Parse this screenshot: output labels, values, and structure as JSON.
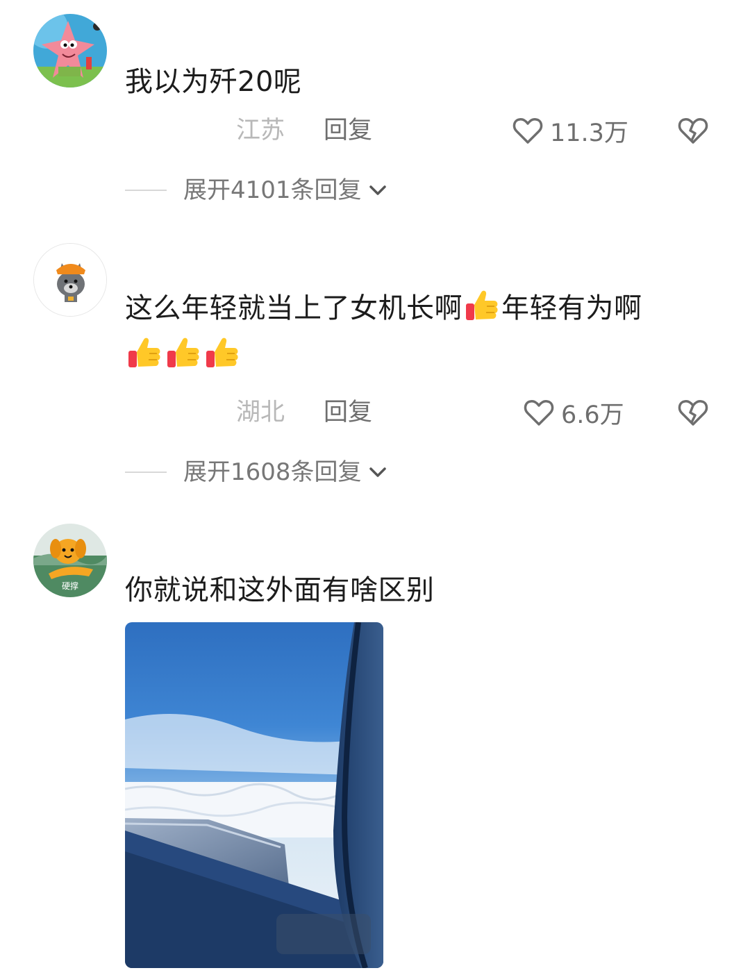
{
  "comments": [
    {
      "avatar_icon": "patrick-star-avatar",
      "text": "我以为歼20呢",
      "location": "江苏",
      "reply_label": "回复",
      "likes": "11.3万",
      "expand_label": "展开4101条回复"
    },
    {
      "avatar_icon": "grey-wolf-avatar",
      "text_part1": "这么年轻就当上了女机长啊",
      "text_part2": "年轻有为啊",
      "emoji": "thumbs-up-emoji",
      "location": "湖北",
      "reply_label": "回复",
      "likes": "6.6万",
      "expand_label": "展开1608条回复"
    },
    {
      "avatar_icon": "orange-dog-avatar",
      "avatar_badge": "硬撑",
      "text": "你就说和这外面有啥区别",
      "image": "airplane-window-photo"
    }
  ],
  "icons": {
    "like": "heart-outline-icon",
    "dislike": "broken-heart-icon",
    "expand": "chevron-down-icon"
  },
  "colors": {
    "text_primary": "#1c1c1c",
    "text_secondary": "#6e6e6e",
    "text_location": "#b8b8b8",
    "divider": "#d8d8d8"
  }
}
